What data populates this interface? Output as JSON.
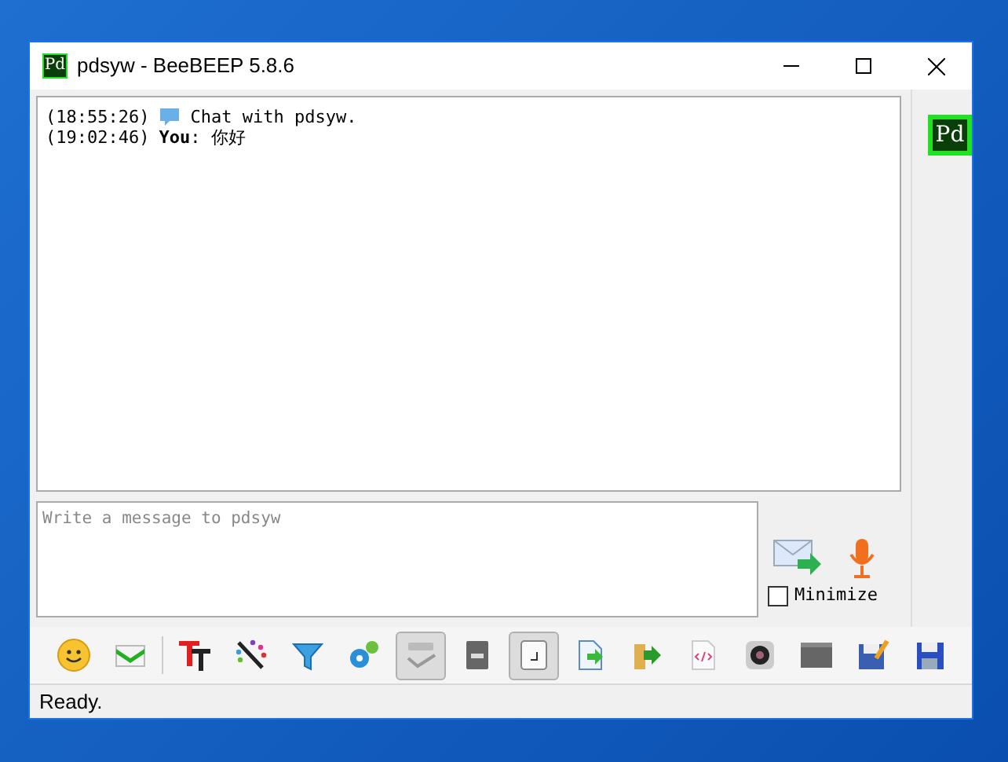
{
  "window": {
    "title": "pdsyw - BeeBEEP 5.8.6",
    "avatar_text": "Pd"
  },
  "chat": {
    "messages": [
      {
        "kind": "system",
        "time": "(18:55:26)",
        "text": "Chat with pdsyw."
      },
      {
        "kind": "user",
        "time": "(19:02:46)",
        "sender": "You",
        "text": ": 你好"
      }
    ]
  },
  "message_box": {
    "placeholder": "Write a message to pdsyw"
  },
  "minimize": {
    "label": "Minimize",
    "checked": false
  },
  "toolbar": [
    {
      "selected": false
    },
    {
      "selected": false
    },
    {
      "selected": false
    },
    {
      "selected": false
    },
    {
      "selected": false
    },
    {
      "selected": false
    },
    {
      "selected": true
    },
    {
      "selected": false
    },
    {
      "selected": true
    },
    {
      "selected": false
    },
    {
      "selected": false
    },
    {
      "selected": false
    },
    {
      "selected": false
    },
    {
      "selected": false
    },
    {
      "selected": false
    },
    {
      "selected": false
    }
  ],
  "side": {
    "avatar_text": "Pd"
  },
  "status_bar": "Ready."
}
